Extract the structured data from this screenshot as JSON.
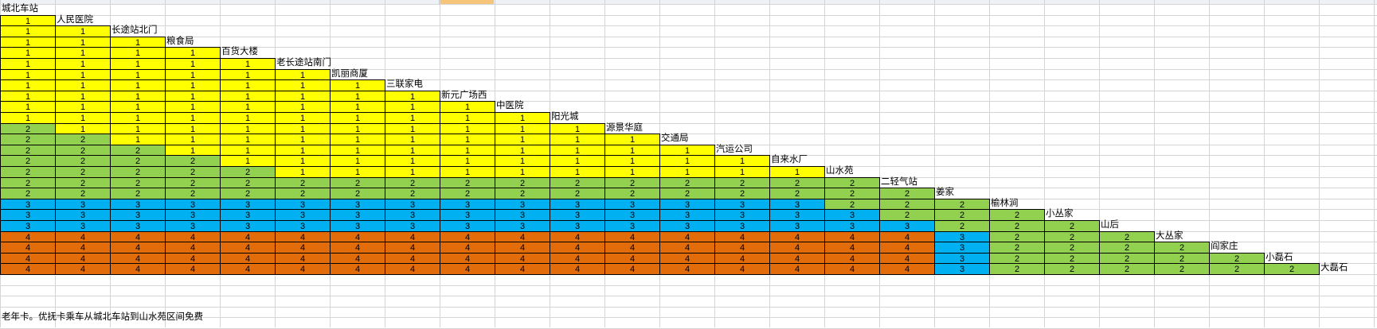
{
  "colors": {
    "zone1": "#ffff00",
    "zone2": "#92d050",
    "zone3": "#00b0f0",
    "zone4": "#e26b0a"
  },
  "stops": [
    "城北车站",
    "人民医院",
    "长途站北门",
    "粮食局",
    "百货大楼",
    "老长途站南门",
    "凯丽商厦",
    "三联家电",
    "新元广场西",
    "中医院",
    "阳光城",
    "源景华庭",
    "交通局",
    "汽运公司",
    "自来水厂",
    "山水苑",
    "二轻气站",
    "姜家",
    "榆林涧",
    "小丛家",
    "山后",
    "大丛家",
    "阎家庄",
    "小磊石",
    "大磊石"
  ],
  "fares": [
    [
      1
    ],
    [
      1,
      1
    ],
    [
      1,
      1,
      1
    ],
    [
      1,
      1,
      1,
      1
    ],
    [
      1,
      1,
      1,
      1,
      1
    ],
    [
      1,
      1,
      1,
      1,
      1,
      1
    ],
    [
      1,
      1,
      1,
      1,
      1,
      1,
      1
    ],
    [
      1,
      1,
      1,
      1,
      1,
      1,
      1,
      1
    ],
    [
      1,
      1,
      1,
      1,
      1,
      1,
      1,
      1,
      1
    ],
    [
      1,
      1,
      1,
      1,
      1,
      1,
      1,
      1,
      1,
      1
    ],
    [
      2,
      1,
      1,
      1,
      1,
      1,
      1,
      1,
      1,
      1,
      1
    ],
    [
      2,
      2,
      1,
      1,
      1,
      1,
      1,
      1,
      1,
      1,
      1,
      1
    ],
    [
      2,
      2,
      2,
      1,
      1,
      1,
      1,
      1,
      1,
      1,
      1,
      1,
      1
    ],
    [
      2,
      2,
      2,
      2,
      1,
      1,
      1,
      1,
      1,
      1,
      1,
      1,
      1,
      1
    ],
    [
      2,
      2,
      2,
      2,
      2,
      1,
      1,
      1,
      1,
      1,
      1,
      1,
      1,
      1,
      1
    ],
    [
      2,
      2,
      2,
      2,
      2,
      2,
      2,
      2,
      2,
      2,
      2,
      2,
      2,
      2,
      2,
      2
    ],
    [
      2,
      2,
      2,
      2,
      2,
      2,
      2,
      2,
      2,
      2,
      2,
      2,
      2,
      2,
      2,
      2,
      2
    ],
    [
      3,
      3,
      3,
      3,
      3,
      3,
      3,
      3,
      3,
      3,
      3,
      3,
      3,
      3,
      3,
      2,
      2,
      2
    ],
    [
      3,
      3,
      3,
      3,
      3,
      3,
      3,
      3,
      3,
      3,
      3,
      3,
      3,
      3,
      3,
      3,
      2,
      2,
      2
    ],
    [
      3,
      3,
      3,
      3,
      3,
      3,
      3,
      3,
      3,
      3,
      3,
      3,
      3,
      3,
      3,
      3,
      3,
      2,
      2,
      2
    ],
    [
      4,
      4,
      4,
      4,
      4,
      4,
      4,
      4,
      4,
      4,
      4,
      4,
      4,
      4,
      4,
      4,
      4,
      3,
      2,
      2,
      2
    ],
    [
      4,
      4,
      4,
      4,
      4,
      4,
      4,
      4,
      4,
      4,
      4,
      4,
      4,
      4,
      4,
      4,
      4,
      3,
      2,
      2,
      2,
      2
    ],
    [
      4,
      4,
      4,
      4,
      4,
      4,
      4,
      4,
      4,
      4,
      4,
      4,
      4,
      4,
      4,
      4,
      4,
      3,
      2,
      2,
      2,
      2,
      2
    ],
    [
      4,
      4,
      4,
      4,
      4,
      4,
      4,
      4,
      4,
      4,
      4,
      4,
      4,
      4,
      4,
      4,
      4,
      3,
      2,
      2,
      2,
      2,
      2,
      2
    ]
  ],
  "note": "老年卡。优抚卡乘车从城北车站到山水苑区间免费"
}
